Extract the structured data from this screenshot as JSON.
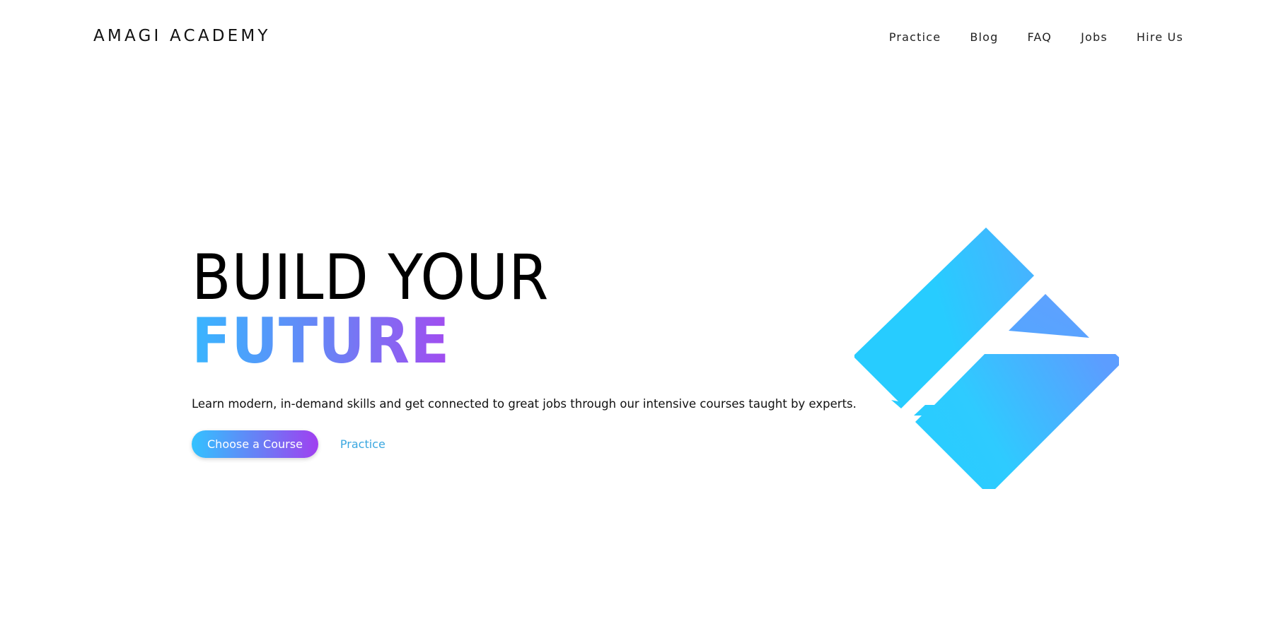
{
  "header": {
    "brand": "AMAGI ACADEMY",
    "nav": [
      {
        "label": "Practice"
      },
      {
        "label": "Blog"
      },
      {
        "label": "FAQ"
      },
      {
        "label": "Jobs"
      },
      {
        "label": "Hire Us"
      }
    ]
  },
  "hero": {
    "headline_line1": "BUILD YOUR",
    "headline_line2": "FUTURE",
    "subtext": "Learn modern, in-demand skills and get connected to great jobs through our intensive courses taught by experts.",
    "primary_button_label": "Choose a Course",
    "secondary_link_label": "Practice"
  },
  "graphic": {
    "icon": "amagi-logo-icon",
    "colors": {
      "cyan": "#27ccff",
      "blue": "#5b9eff"
    }
  },
  "colors": {
    "gradient_start": "#38b6ff",
    "gradient_end": "#a24cf0",
    "link": "#3aa7e0"
  }
}
